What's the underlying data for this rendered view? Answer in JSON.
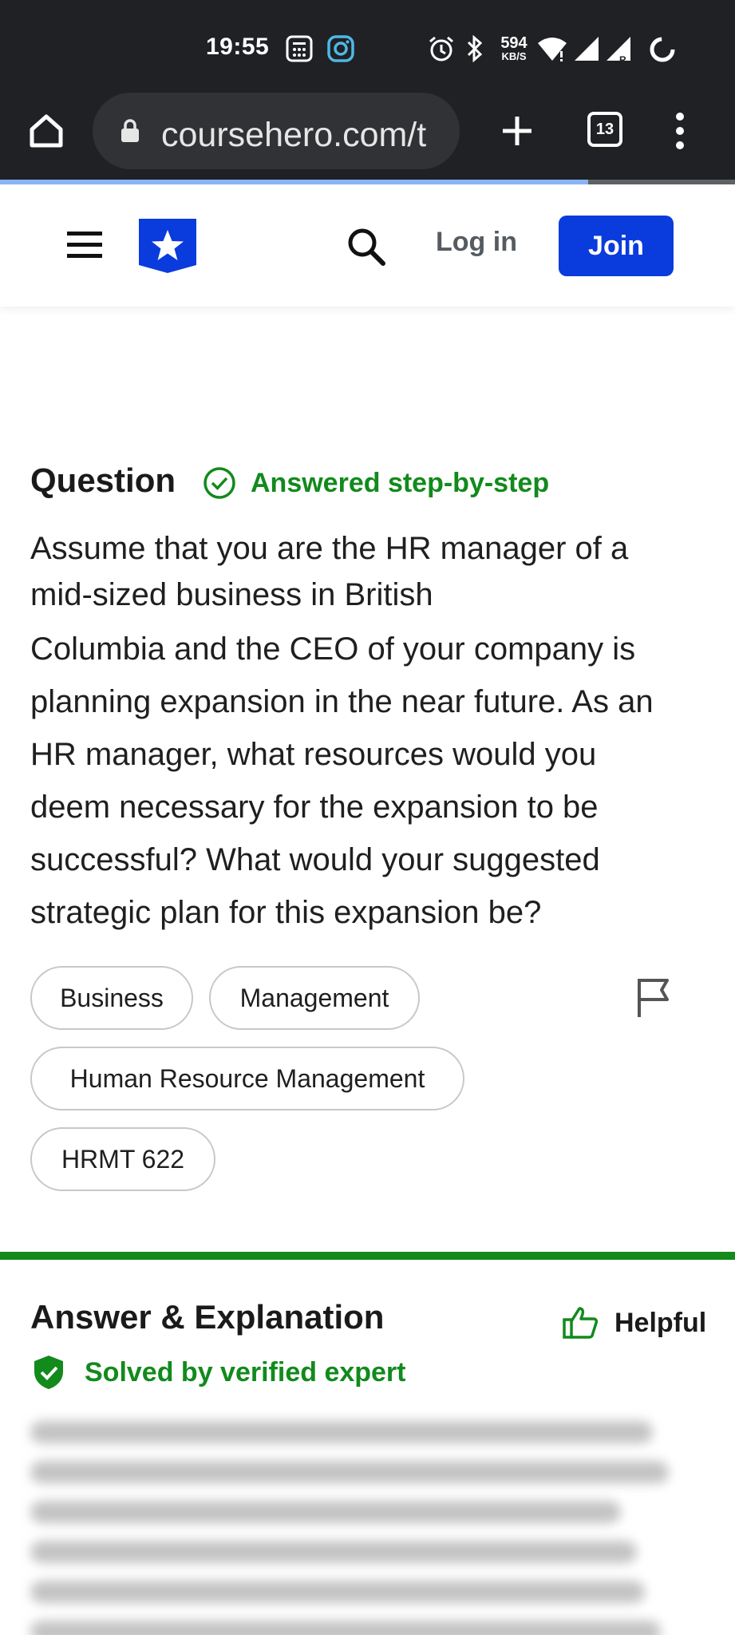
{
  "status_bar": {
    "time": "19:55",
    "net_speed_value": "594",
    "net_speed_unit": "KB/S",
    "icons": [
      "calculator-icon",
      "instagram-icon",
      "alarm-icon",
      "bluetooth-icon",
      "wifi-icon",
      "signal-icon",
      "signal-roaming-icon",
      "battery-ring-icon"
    ]
  },
  "browser": {
    "url": "coursehero.com/t",
    "tab_count": "13",
    "load_progress": 0.8
  },
  "site_header": {
    "login_label": "Log in",
    "join_label": "Join",
    "brand_color": "#0a3bdc"
  },
  "question": {
    "heading": "Question",
    "status": "Answered step-by-step",
    "lines": [
      "Assume that you are the HR manager of a",
      "mid-sized business in British",
      "Columbia and the CEO of your company is",
      "planning expansion in the near future. As an",
      "HR manager, what resources would you",
      "deem necessary for the expansion to be",
      "successful? What would your suggested",
      "strategic plan for this expansion be?"
    ],
    "tags": [
      "Business",
      "Management",
      "Human Resource Management",
      "HRMT 622"
    ]
  },
  "answer": {
    "heading": "Answer & Explanation",
    "helpful_label": "Helpful",
    "verified_label": "Solved by verified expert",
    "accent_color": "#128a1c"
  }
}
